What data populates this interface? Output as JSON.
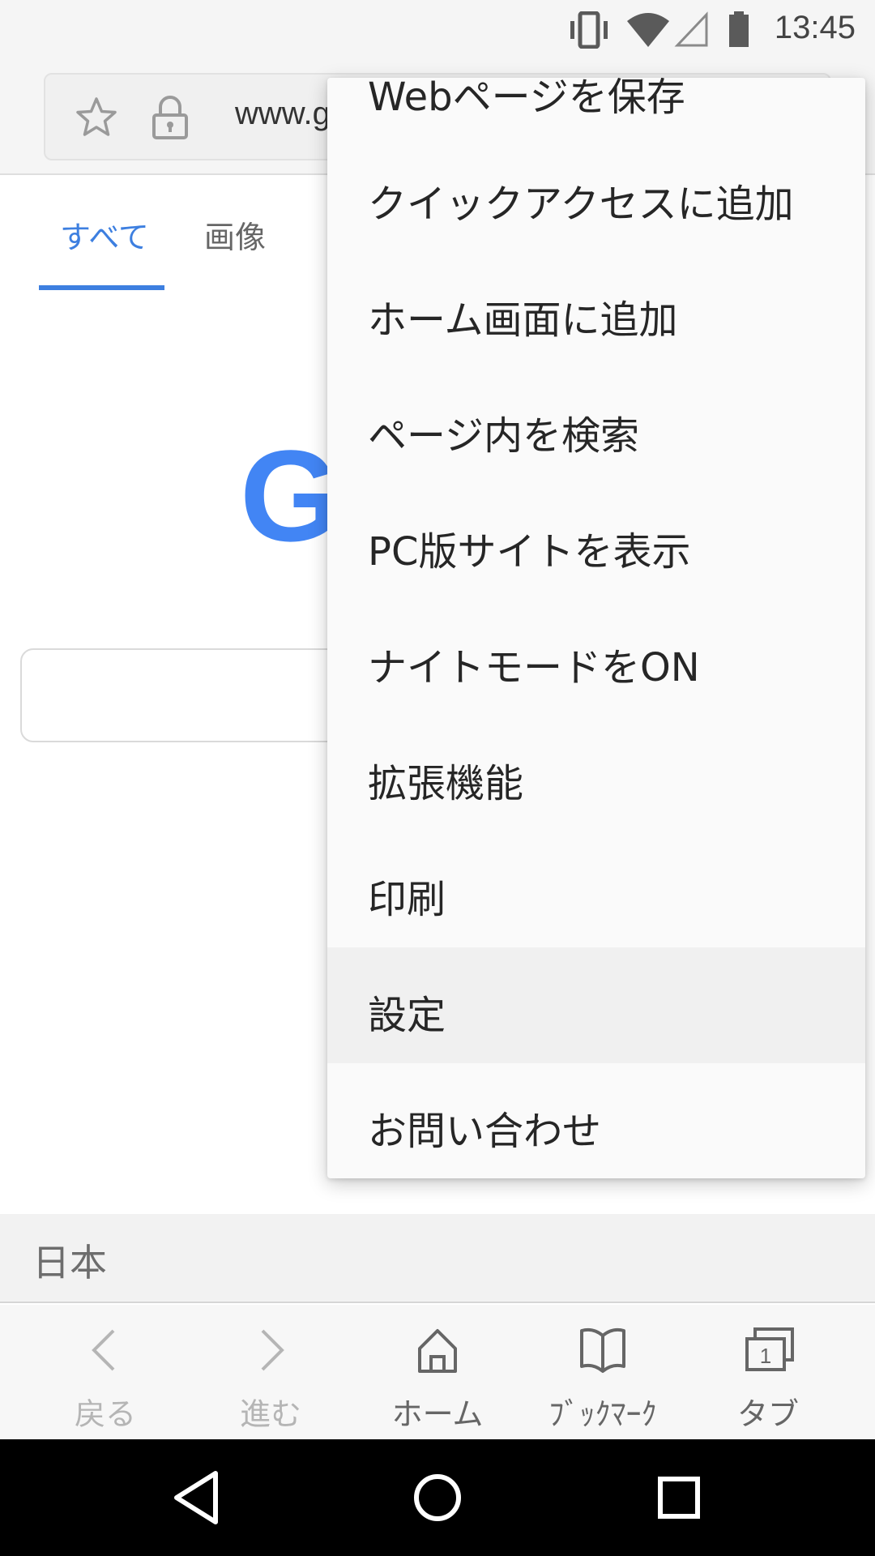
{
  "status_bar": {
    "time": "13:45",
    "icons": [
      "vibrate-icon",
      "wifi-icon",
      "signal-icon",
      "battery-icon"
    ]
  },
  "address_bar": {
    "url_visible": "www.g",
    "icons": [
      "star-icon",
      "lock-icon"
    ]
  },
  "search_tabs": [
    {
      "label": "すべて",
      "active": true
    },
    {
      "label": "画像",
      "active": false
    }
  ],
  "google_logo_visible": "G",
  "footer": {
    "country": "日本"
  },
  "menu": {
    "items": [
      {
        "label": "Webページを保存"
      },
      {
        "label": "クイックアクセスに追加"
      },
      {
        "label": "ホーム画面に追加"
      },
      {
        "label": "ページ内を検索"
      },
      {
        "label": "PC版サイトを表示"
      },
      {
        "label": "ナイトモードをON"
      },
      {
        "label": "拡張機能"
      },
      {
        "label": "印刷"
      },
      {
        "label": "設定",
        "highlighted": true
      },
      {
        "label": "お問い合わせ"
      }
    ]
  },
  "bottom_nav": [
    {
      "label": "戻る",
      "icon": "chevron-left-icon",
      "enabled": false
    },
    {
      "label": "進む",
      "icon": "chevron-right-icon",
      "enabled": false
    },
    {
      "label": "ホーム",
      "icon": "home-icon",
      "enabled": true
    },
    {
      "label": "ﾌﾞｯｸﾏｰｸ",
      "icon": "bookmark-icon",
      "enabled": true
    },
    {
      "label": "タブ",
      "icon": "tabs-icon",
      "enabled": true,
      "badge": "1"
    }
  ],
  "system_nav": [
    "back-triangle-icon",
    "home-circle-icon",
    "recents-square-icon"
  ],
  "colors": {
    "accent": "#3d7fe0",
    "google_blue": "#4285f4"
  }
}
